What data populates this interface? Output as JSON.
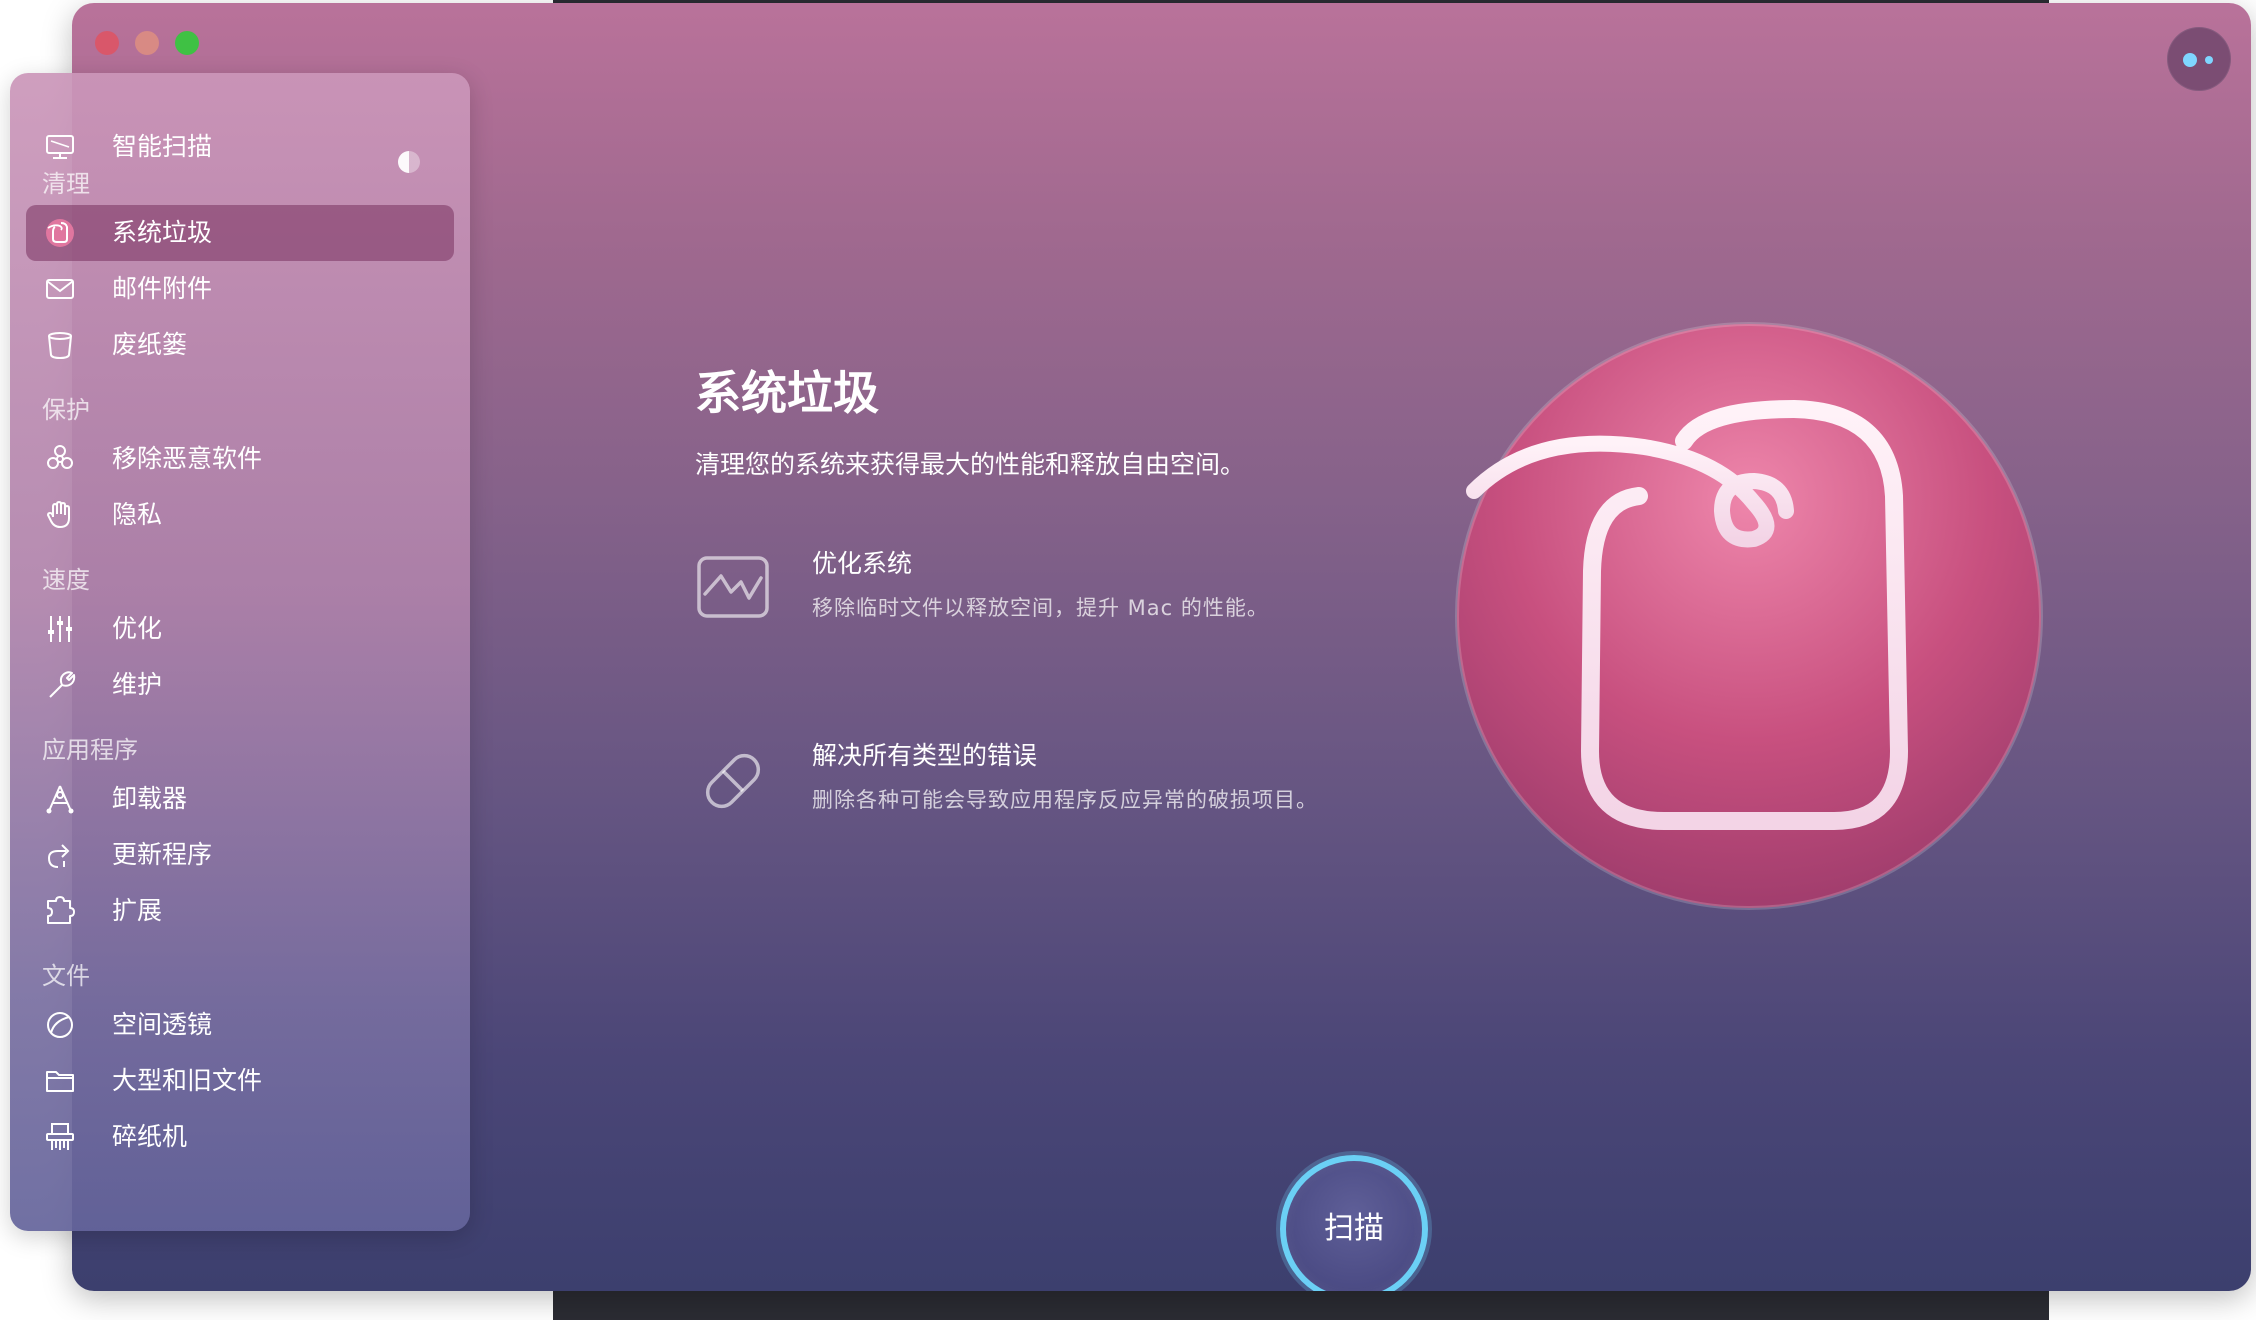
{
  "colors": {
    "accent_ring": "#6bd0f5",
    "selected_item_bg": "#7a325f",
    "close": "#d9576a",
    "minimize": "#d88a84",
    "zoom": "#3fc144"
  },
  "sidebar": {
    "top_item": {
      "label": "智能扫描",
      "icon": "monitor-icon"
    },
    "sections": [
      {
        "title": "清理",
        "items": [
          {
            "label": "系统垃圾",
            "icon": "system-junk-icon",
            "selected": true
          },
          {
            "label": "邮件附件",
            "icon": "envelope-icon"
          },
          {
            "label": "废纸篓",
            "icon": "trash-bin-icon"
          }
        ]
      },
      {
        "title": "保护",
        "items": [
          {
            "label": "移除恶意软件",
            "icon": "biohazard-icon"
          },
          {
            "label": "隐私",
            "icon": "hand-icon"
          }
        ]
      },
      {
        "title": "速度",
        "items": [
          {
            "label": "优化",
            "icon": "sliders-icon"
          },
          {
            "label": "维护",
            "icon": "wrench-icon"
          }
        ]
      },
      {
        "title": "应用程序",
        "items": [
          {
            "label": "卸载器",
            "icon": "uninstaller-icon"
          },
          {
            "label": "更新程序",
            "icon": "update-arrow-icon"
          },
          {
            "label": "扩展",
            "icon": "puzzle-icon"
          }
        ]
      },
      {
        "title": "文件",
        "items": [
          {
            "label": "空间透镜",
            "icon": "space-lens-icon"
          },
          {
            "label": "大型和旧文件",
            "icon": "folder-icon"
          },
          {
            "label": "碎纸机",
            "icon": "shredder-icon"
          }
        ]
      }
    ]
  },
  "main": {
    "title": "系统垃圾",
    "subtitle": "清理您的系统来获得最大的性能和释放自由空间。",
    "features": [
      {
        "title": "优化系统",
        "desc": "移除临时文件以释放空间，提升 Mac 的性能。",
        "icon": "pulse-monitor-icon"
      },
      {
        "title": "解决所有类型的错误",
        "desc": "删除各种可能会导致应用程序反应异常的破损项目。",
        "icon": "pill-icon"
      }
    ],
    "scan_button": "扫描"
  }
}
